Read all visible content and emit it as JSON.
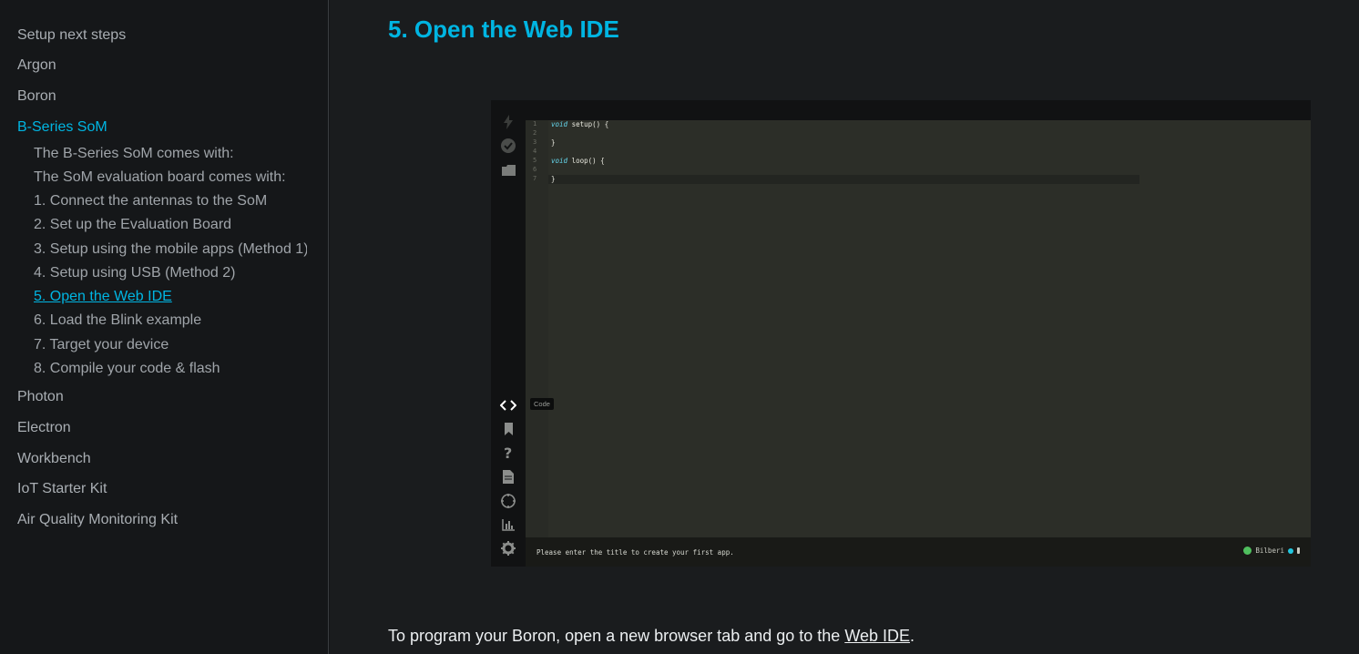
{
  "sidebar": {
    "top_items": [
      {
        "label": "Setup next steps"
      },
      {
        "label": "Argon"
      },
      {
        "label": "Boron"
      },
      {
        "label": "B-Series SoM"
      },
      {
        "label": "Photon"
      },
      {
        "label": "Electron"
      },
      {
        "label": "Workbench"
      },
      {
        "label": "IoT Starter Kit"
      },
      {
        "label": "Air Quality Monitoring Kit"
      }
    ],
    "active_top": "B-Series SoM",
    "sub_items": [
      {
        "label": "The B-Series SoM comes with:"
      },
      {
        "label": "The SoM evaluation board comes with:"
      },
      {
        "label": "1. Connect the antennas to the SoM"
      },
      {
        "label": "2. Set up the Evaluation Board"
      },
      {
        "label": "3. Setup using the mobile apps (Method 1)"
      },
      {
        "label": "4. Setup using USB (Method 2)"
      },
      {
        "label": "5. Open the Web IDE"
      },
      {
        "label": "6. Load the Blink example"
      },
      {
        "label": "7. Target your device"
      },
      {
        "label": "8. Compile your code & flash"
      }
    ],
    "active_sub": "5. Open the Web IDE"
  },
  "main": {
    "heading": "5. Open the Web IDE",
    "paragraph_prefix": "To program your Boron, open a new browser tab and go to the ",
    "paragraph_link": "Web IDE",
    "paragraph_suffix": "."
  },
  "ide": {
    "line_numbers": [
      "1",
      "2",
      "3",
      "4",
      "5",
      "6",
      "7"
    ],
    "code": {
      "l1_kw": "void",
      "l1_rest": " setup() {",
      "l3": "}",
      "l5_kw": "void",
      "l5_rest": " loop() {",
      "l7": "}"
    },
    "tooltip": "Code",
    "status_message": "Please enter the title to create your first app.",
    "user_name": "Bilberi",
    "icons": [
      "flash-icon",
      "verify-icon",
      "folder-icon",
      "code-icon",
      "bookmark-icon",
      "help-icon",
      "docs-icon",
      "devices-icon",
      "console-icon",
      "settings-icon"
    ]
  },
  "colors": {
    "accent": "#00b5e2",
    "background": "#151719",
    "editor_bg": "#2c2e28"
  }
}
